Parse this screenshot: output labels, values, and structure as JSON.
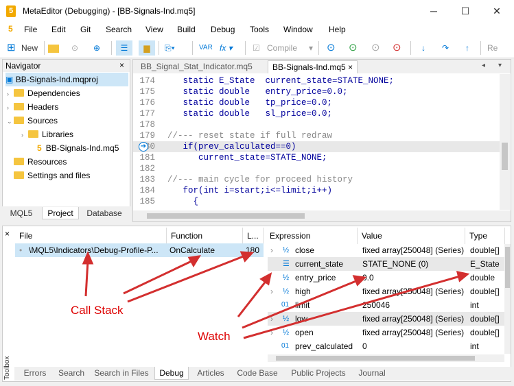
{
  "window": {
    "title": "MetaEditor (Debugging) - [BB-Signals-Ind.mq5]",
    "app_icon": "5"
  },
  "controls": {
    "minimize": "─",
    "maximize": "☐",
    "close": "✕"
  },
  "menu": [
    "File",
    "Edit",
    "Git",
    "Search",
    "View",
    "Build",
    "Debug",
    "Tools",
    "Window",
    "Help"
  ],
  "toolbar": {
    "new_label": "New",
    "compile_label": "Compile",
    "re_label": "Re"
  },
  "navigator": {
    "title": "Navigator",
    "close": "×",
    "items": [
      {
        "label": "BB-Signals-Ind.mqproj"
      },
      {
        "label": "Dependencies"
      },
      {
        "label": "Headers"
      },
      {
        "label": "Sources"
      },
      {
        "label": "Libraries"
      },
      {
        "label": "BB-Signals-Ind.mq5"
      },
      {
        "label": "Resources"
      },
      {
        "label": "Settings and files"
      }
    ],
    "tabs": [
      "MQL5",
      "Project",
      "Database"
    ]
  },
  "editor": {
    "tabs": [
      "BB_Signal_Stat_Indicator.mq5",
      "BB-Signals-Ind.mq5"
    ],
    "lines": [
      {
        "n": "174",
        "code": "   static E_State  current_state=STATE_NONE;"
      },
      {
        "n": "175",
        "code": "   static double   entry_price=0.0;"
      },
      {
        "n": "176",
        "code": "   static double   tp_price=0.0;"
      },
      {
        "n": "177",
        "code": "   static double   sl_price=0.0;"
      },
      {
        "n": "178",
        "code": ""
      },
      {
        "n": "179",
        "code": "//--- reset state if full redraw"
      },
      {
        "n": "180",
        "code": "   if(prev_calculated==0)"
      },
      {
        "n": "181",
        "code": "      current_state=STATE_NONE;"
      },
      {
        "n": "182",
        "code": ""
      },
      {
        "n": "183",
        "code": "//--- main cycle for proceed history"
      },
      {
        "n": "184",
        "code": "   for(int i=start;i<=limit;i++)"
      },
      {
        "n": "185",
        "code": "     {"
      }
    ]
  },
  "callstack": {
    "headers": [
      "File",
      "Function",
      "L..."
    ],
    "row": {
      "file": "\\MQL5\\Indicators\\Debug-Profile-P...",
      "function": "OnCalculate",
      "line": "180"
    }
  },
  "watch": {
    "headers": [
      "Expression",
      "Value",
      "Type"
    ],
    "rows": [
      {
        "expr": "close",
        "value": "fixed array[250048] (Series)",
        "type": "double[]"
      },
      {
        "expr": "current_state",
        "value": "STATE_NONE (0)",
        "type": "E_State"
      },
      {
        "expr": "entry_price",
        "value": "0.0",
        "type": "double"
      },
      {
        "expr": "high",
        "value": "fixed array[250048] (Series)",
        "type": "double[]"
      },
      {
        "expr": "limit",
        "value": "250046",
        "type": "int"
      },
      {
        "expr": "low",
        "value": "fixed array[250048] (Series)",
        "type": "double[]"
      },
      {
        "expr": "open",
        "value": "fixed array[250048] (Series)",
        "type": "double[]"
      },
      {
        "expr": "prev_calculated",
        "value": "0",
        "type": "int"
      }
    ]
  },
  "bottom_tabs": [
    "Errors",
    "Search",
    "Search in Files",
    "Debug",
    "Articles",
    "Code Base",
    "Public Projects",
    "Journal"
  ],
  "toolbox_label": "Toolbox",
  "annotations": {
    "call_stack": "Call Stack",
    "watch": "Watch"
  },
  "colors": {
    "accent": "#0078d7",
    "annotation": "#d32f2f"
  }
}
